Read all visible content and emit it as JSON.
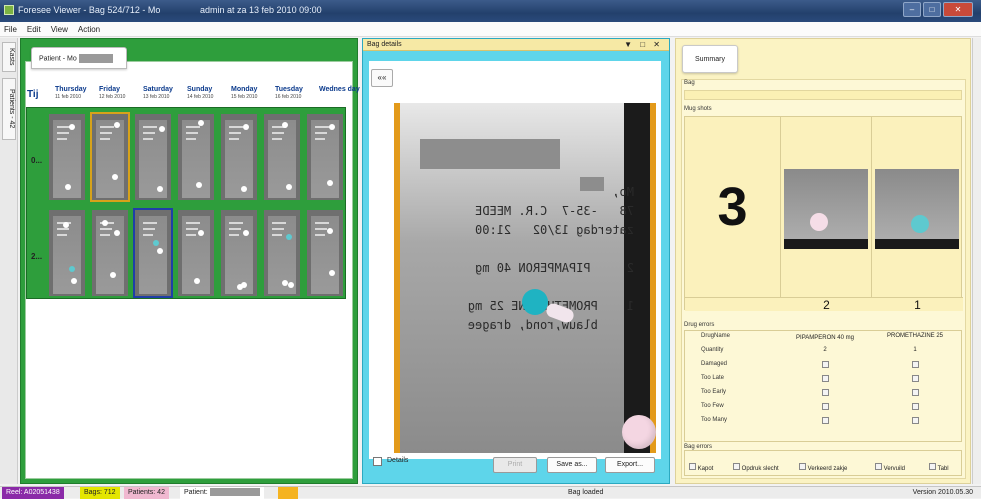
{
  "window": {
    "title": "Foresee Viewer - Bag 524/712 - Mo",
    "title_user": "admin at za 13 feb 2010 09:00",
    "min": "–",
    "max": "□",
    "close": "✕"
  },
  "menu": [
    "File",
    "Edit",
    "View",
    "Action"
  ],
  "side_tabs": {
    "left": [
      "Kasts",
      "Patients - 42"
    ]
  },
  "patient_tab": {
    "label": "Patient - Mo"
  },
  "timeline": {
    "tij": "Tij",
    "days": [
      {
        "name": "Thursday",
        "date": "11 feb 2010"
      },
      {
        "name": "Friday",
        "date": "12 feb 2010"
      },
      {
        "name": "Saturday",
        "date": "13 feb 2010"
      },
      {
        "name": "Sunday",
        "date": "14 feb 2010"
      },
      {
        "name": "Monday",
        "date": "15 feb 2010"
      },
      {
        "name": "Tuesday",
        "date": "16 feb 2010"
      },
      {
        "name": "Wednes day",
        "date": ""
      }
    ],
    "rows": [
      "0...",
      "2..."
    ]
  },
  "bag_details": {
    "header": "Bag details",
    "header_controls": "▼ □ ✕",
    "back_button": "««",
    "print_lines": [
      "Mo,",
      "78   -35-7  C.R. MEEDE",
      "zaterdag 13/02   21:00",
      "",
      "2     PIPAMPERON 40 mg",
      "",
      "1    PROMETHAZINE 25 mg",
      "     blauw,rond, dragee"
    ],
    "details_label": "Details",
    "print_button": "Print",
    "saveas_button": "Save as...",
    "export_button": "Export..."
  },
  "summary": {
    "tab": "Summary",
    "bag_label": "Bag",
    "mug_label": "Mug shots",
    "count": "3",
    "mug_numbers": [
      "2",
      "1"
    ],
    "drug_errors_label": "Drug errors",
    "drug_table": {
      "header": {
        "label": "DrugName",
        "c1": "PIPAMPERON 40 mg",
        "c2": "PROMETHAZINE 25"
      },
      "quantity": {
        "label": "Quantity",
        "c1": "2",
        "c2": "1"
      },
      "flags": [
        "Damaged",
        "Too Late",
        "Too Early",
        "Too Few",
        "Too Many"
      ]
    },
    "bag_errors_label": "Bag errors",
    "bag_errors": [
      "Kapot",
      "Opdruk slecht",
      "Verkeerd zakje",
      "Vervuild",
      "Tabl"
    ]
  },
  "statusbar": {
    "reel": "Reel: A02051438",
    "bags": "Bags: 712",
    "patients": "Patients: 42",
    "patient": "Patient:",
    "status": "Bag loaded",
    "version": "Version 2010.05.30"
  },
  "colors": {
    "left_panel": "#2e9e3c",
    "mid_panel": "#5ed5ea",
    "right_panel": "#fbf3c3",
    "reel": "#8b2aa8",
    "bags": "#e4e600",
    "patients": "#f0b8d0",
    "patient_badge": "#f5b320"
  }
}
